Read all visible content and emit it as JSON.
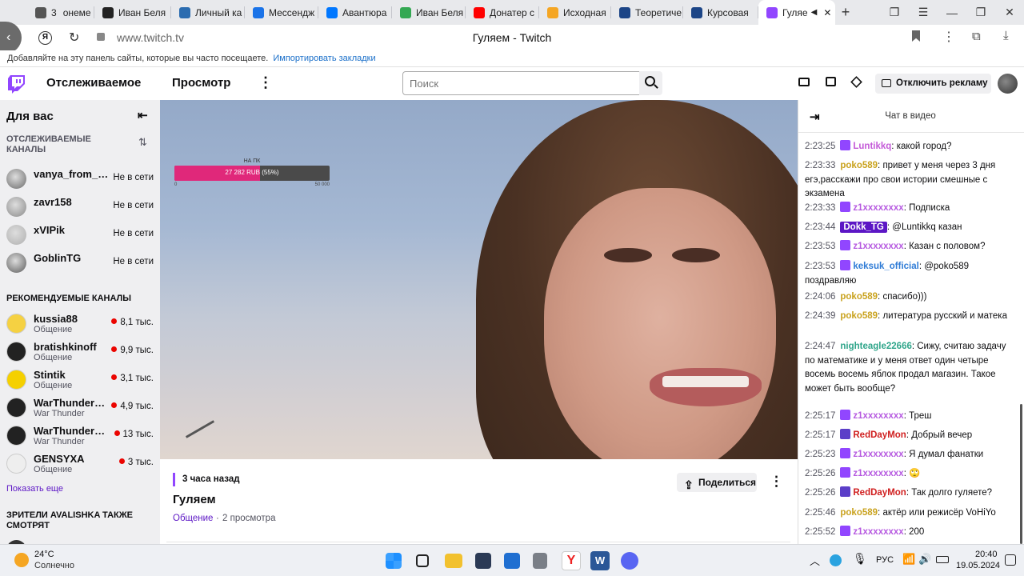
{
  "browser": {
    "tabs": [
      {
        "label": "3",
        "extra": "онеме",
        "color": "#555555"
      },
      {
        "label": "Иван Беля",
        "color": "#222222"
      },
      {
        "label": "Личный ка",
        "color": "#2b6cb0"
      },
      {
        "label": "Мессендж",
        "color": "#1a73e8"
      },
      {
        "label": "Авантюра",
        "color": "#0077ff"
      },
      {
        "label": "Иван Беля",
        "color": "#34a853"
      },
      {
        "label": "Донатер с",
        "color": "#ff0000"
      },
      {
        "label": "Исходная",
        "color": "#f5a623"
      },
      {
        "label": "Теоретиче",
        "color": "#1c4587"
      },
      {
        "label": "Курсовая",
        "color": "#1c4587"
      },
      {
        "label": "Гуляе",
        "color": "#9146ff",
        "active": true
      }
    ],
    "url": "www.twitch.tv",
    "page_title": "Гуляем - Twitch",
    "bookmarks_text": "Добавляйте на эту панель сайты, которые вы часто посещаете.",
    "bookmarks_link": "Импортировать закладки"
  },
  "nav": {
    "following": "Отслеживаемое",
    "browse": "Просмотр",
    "search_placeholder": "Поиск",
    "ads_button": "Отключить рекламу"
  },
  "sidebar": {
    "title": "Для вас",
    "followed_header": "ОТСЛЕЖИВАЕМЫЕ КАНАЛЫ",
    "followed": [
      {
        "name": "vanya_from_ba...",
        "status": "Не в сети"
      },
      {
        "name": "zavr158",
        "status": "Не в сети"
      },
      {
        "name": "xVIPik",
        "status": "Не в сети"
      },
      {
        "name": "GoblinTG",
        "status": "Не в сети"
      }
    ],
    "recommended_header": "РЕКОМЕНДУЕМЫЕ КАНАЛЫ",
    "recommended": [
      {
        "name": "kussia88",
        "category": "Общение",
        "viewers": "8,1 тыс."
      },
      {
        "name": "bratishkinoff",
        "category": "Общение",
        "viewers": "9,9 тыс."
      },
      {
        "name": "Stintik",
        "category": "Общение",
        "viewers": "3,1 тыс."
      },
      {
        "name": "WarThunder_e...",
        "category": "War Thunder",
        "viewers": "4,9 тыс."
      },
      {
        "name": "WarThunder_e...",
        "category": "War Thunder",
        "viewers": "13 тыс."
      },
      {
        "name": "GENSYXA",
        "category": "Общение",
        "viewers": "3 тыс."
      }
    ],
    "show_more": "Показать еще",
    "also_watch_header": "ЗРИТЕЛИ AVALISHKA ТАКЖЕ СМОТРЯТ"
  },
  "video": {
    "donation_title": "НА ПК",
    "donation_text": "27 282 RUB (55%)",
    "donation_progress": 0.55,
    "donation_min": "0",
    "donation_max": "50 000"
  },
  "info": {
    "time_ago": "3 часа назад",
    "title": "Гуляем",
    "category": "Общение",
    "views": "2 просмотра",
    "share": "Поделиться"
  },
  "chat": {
    "header": "Чат в видео",
    "messages": [
      {
        "time": "2:23:25",
        "user": "Luntikkq",
        "color": "#c45ad8",
        "badge": "#9146ff",
        "text": "какой город?"
      },
      {
        "time": "2:23:33",
        "user": "poko589",
        "color": "#c9a21e",
        "badge": "",
        "text": "привет у меня через 3 дня егэ,расскажи про свои истории смешные с экзамена"
      },
      {
        "time": "2:23:33",
        "user": "z1xxxxxxxx",
        "color": "#b65ae0",
        "badge": "#9146ff",
        "text": "Подписка"
      },
      {
        "time": "2:23:44",
        "user": "Dokk_TG",
        "color": "#ffffff",
        "badge": "",
        "highlight": true,
        "text": "@Luntikkq казан"
      },
      {
        "time": "2:23:53",
        "user": "z1xxxxxxxx",
        "color": "#b65ae0",
        "badge": "#9146ff",
        "text": "Казан с половом?"
      },
      {
        "time": "2:23:53",
        "user": "keksuk_official",
        "color": "#2e7bd6",
        "badge": "#9146ff",
        "text": "@poko589 поздравляю"
      },
      {
        "time": "2:24:06",
        "user": "poko589",
        "color": "#c9a21e",
        "badge": "",
        "text": "спасибо)))"
      },
      {
        "time": "2:24:39",
        "user": "poko589",
        "color": "#c9a21e",
        "badge": "",
        "text": "литература русский и матека"
      },
      {
        "time": "2:24:47",
        "user": "nighteagle22666",
        "color": "#2fa58a",
        "badge": "",
        "text": "Сижу, считаю задачу по математике и у меня ответ один четыре восемь восемь яблок продал магазин. Такое может быть вообще?"
      },
      {
        "time": "2:25:17",
        "user": "z1xxxxxxxx",
        "color": "#b65ae0",
        "badge": "#9146ff",
        "text": "Треш"
      },
      {
        "time": "2:25:17",
        "user": "RedDayMon",
        "color": "#d02020",
        "badge": "#5b3ec8",
        "text": "Добрый вечер"
      },
      {
        "time": "2:25:23",
        "user": "z1xxxxxxxx",
        "color": "#b65ae0",
        "badge": "#9146ff",
        "text": "Я думал фанатки"
      },
      {
        "time": "2:25:26",
        "user": "z1xxxxxxxx",
        "color": "#b65ae0",
        "badge": "#9146ff",
        "text": "🙄"
      },
      {
        "time": "2:25:26",
        "user": "RedDayMon",
        "color": "#d02020",
        "badge": "#5b3ec8",
        "text": "Так долго гуляете?"
      },
      {
        "time": "2:25:46",
        "user": "poko589",
        "color": "#c9a21e",
        "badge": "",
        "text": "актёр или режисёр VoHiYo"
      },
      {
        "time": "2:25:52",
        "user": "z1xxxxxxxx",
        "color": "#b65ae0",
        "badge": "#9146ff",
        "text": "200"
      }
    ]
  },
  "taskbar": {
    "weather_temp": "24°C",
    "weather_desc": "Солнечно",
    "lang": "РУС",
    "time": "20:40",
    "date": "19.05.2024"
  }
}
